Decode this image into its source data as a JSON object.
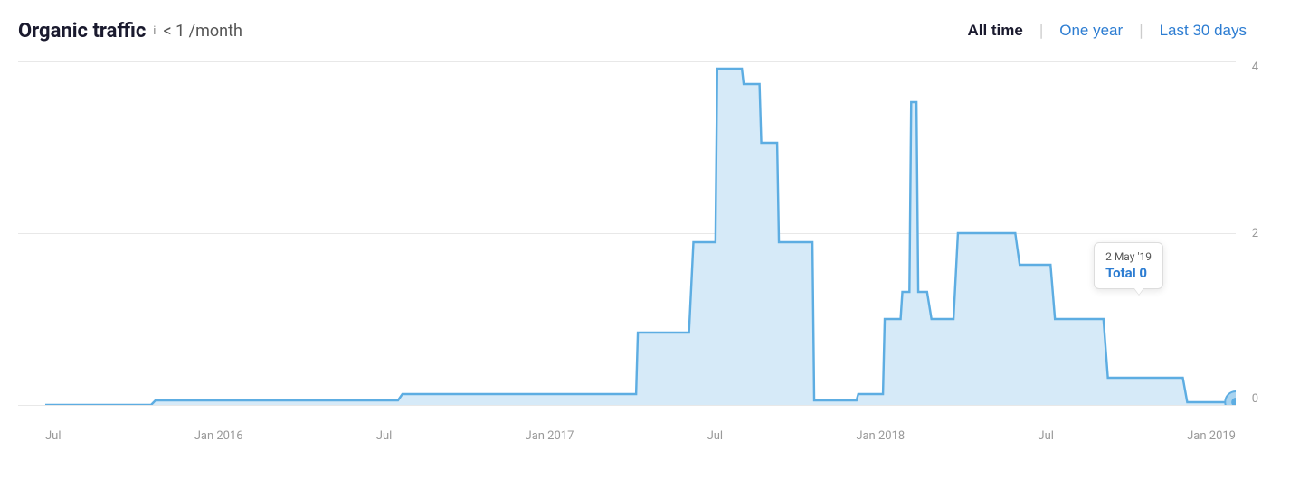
{
  "header": {
    "title": "Organic traffic",
    "info_icon": "i",
    "subtitle": "< 1 /month"
  },
  "time_filters": [
    {
      "label": "All time",
      "active": true
    },
    {
      "label": "One year",
      "active": false
    },
    {
      "label": "Last 30 days",
      "active": false
    }
  ],
  "y_axis": {
    "labels": [
      "4",
      "2",
      "0"
    ]
  },
  "x_axis": {
    "labels": [
      "Jul",
      "Jan 2016",
      "Jul",
      "Jan 2017",
      "Jul",
      "Jan 2018",
      "Jul",
      "Jan 2019"
    ]
  },
  "tooltip": {
    "date": "2 May '19",
    "label": "Total 0"
  },
  "colors": {
    "fill": "#d6eaf8",
    "stroke": "#5dade2",
    "tooltip_value": "#2d7dd2"
  }
}
